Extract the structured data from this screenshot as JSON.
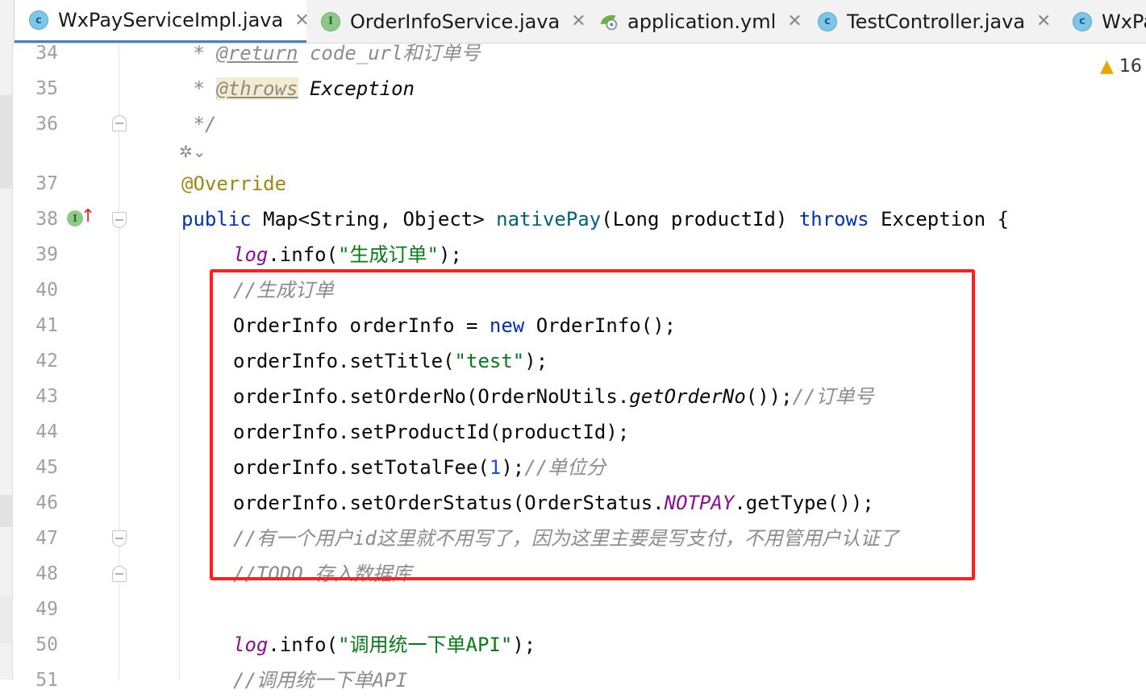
{
  "tabs": [
    {
      "label": "WxPayServiceImpl.java",
      "icon": "class-icon",
      "active": true
    },
    {
      "label": "OrderInfoService.java",
      "icon": "interface-icon"
    },
    {
      "label": "application.yml",
      "icon": "yml-icon"
    },
    {
      "label": "TestController.java",
      "icon": "class-icon"
    },
    {
      "label": "WxPa",
      "icon": "class-icon"
    }
  ],
  "tab_close_glyph": "✕",
  "warnings": {
    "count": "16"
  },
  "gutter": {
    "line_numbers": [
      "34",
      "35",
      "36",
      "37",
      "38",
      "39",
      "40",
      "41",
      "42",
      "43",
      "44",
      "45",
      "46",
      "47",
      "48",
      "49",
      "50",
      "51"
    ],
    "impl_marker": "I"
  },
  "code": {
    "l34": {
      "star": " * ",
      "tag": "@return",
      "rest": " code_url和订单号"
    },
    "l35": {
      "star": " * ",
      "tag": "@throws",
      "rest": " Exception"
    },
    "l36": " */",
    "l37": "@Override",
    "l38": {
      "kw1": "public",
      "t1": " Map<String, Object> ",
      "meth": "nativePay",
      "t2": "(Long productId) ",
      "kw2": "throws",
      "t3": " Exception {"
    },
    "l39": {
      "fld": "log",
      "t1": ".info(",
      "str": "\"生成订单\"",
      "t2": ");"
    },
    "l40": "//生成订单",
    "l41": {
      "t1": "OrderInfo orderInfo = ",
      "kw": "new",
      "t2": " OrderInfo();"
    },
    "l42": {
      "t1": "orderInfo.setTitle(",
      "str": "\"test\"",
      "t2": ");"
    },
    "l43": {
      "t1": "orderInfo.setOrderNo(OrderNoUtils.",
      "st": "getOrderNo",
      "t2": "());",
      "cmt": "//订单号"
    },
    "l44": "orderInfo.setProductId(productId);",
    "l45": {
      "t1": "orderInfo.setTotalFee(",
      "num": "1",
      "t2": ");",
      "cmt": "//单位分"
    },
    "l46": {
      "t1": "orderInfo.setOrderStatus(OrderStatus.",
      "const": "NOTPAY",
      "t2": ".getType());"
    },
    "l47": "//有一个用户id这里就不用写了，因为这里主要是写支付，不用管用户认证了",
    "l48": "//TODO 存入数据库",
    "l50": {
      "fld": "log",
      "t1": ".info(",
      "str": "\"调用统一下单API\"",
      "t2": ");"
    },
    "l51": "//调用统一下单API"
  },
  "colors": {
    "highlight_box": "#ff1f1f",
    "active_tab_underline": "#4083c9"
  }
}
